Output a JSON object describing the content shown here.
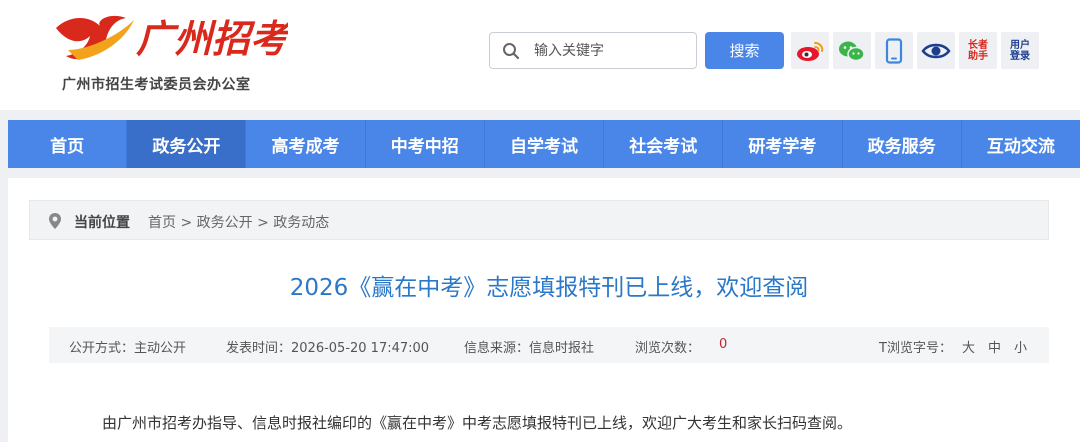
{
  "header": {
    "logo_text": "广州招考",
    "site_subtitle": "广州市招生考试委员会办公室",
    "search_placeholder": "输入关键字",
    "search_button": "搜索",
    "tools": {
      "elder_help": [
        "长者",
        "助手"
      ],
      "user_login": [
        "用户",
        "登录"
      ]
    }
  },
  "nav": {
    "items": [
      "首页",
      "政务公开",
      "高考成考",
      "中考中招",
      "自学考试",
      "社会考试",
      "研考学考",
      "政务服务",
      "互动交流"
    ],
    "active": "政务公开"
  },
  "breadcrumb": {
    "label": "当前位置",
    "path": "首页 > 政务公开 > 政务动态"
  },
  "article": {
    "title": "2026《赢在中考》志愿填报特刊已上线，欢迎查阅",
    "meta": {
      "disclosure": "公开方式：主动公开",
      "published": "发表时间：2026-05-20 17:47:00",
      "source": "信息来源：信息时报社",
      "views_label": "浏览次数：",
      "views": "0",
      "font_label": "T浏览字号：",
      "font_large": "大",
      "font_medium": "中",
      "font_small": "小"
    },
    "body_first_line": "由广州市招考办指导、信息时报社编印的《赢在中考》中考志愿填报特刊已上线，欢迎广大考生和家长扫码查阅。"
  },
  "colors": {
    "nav_blue": "#4a86e8",
    "title_blue": "#2b78c8",
    "logo_red": "#d9281c",
    "views_red": "#c0282d"
  }
}
